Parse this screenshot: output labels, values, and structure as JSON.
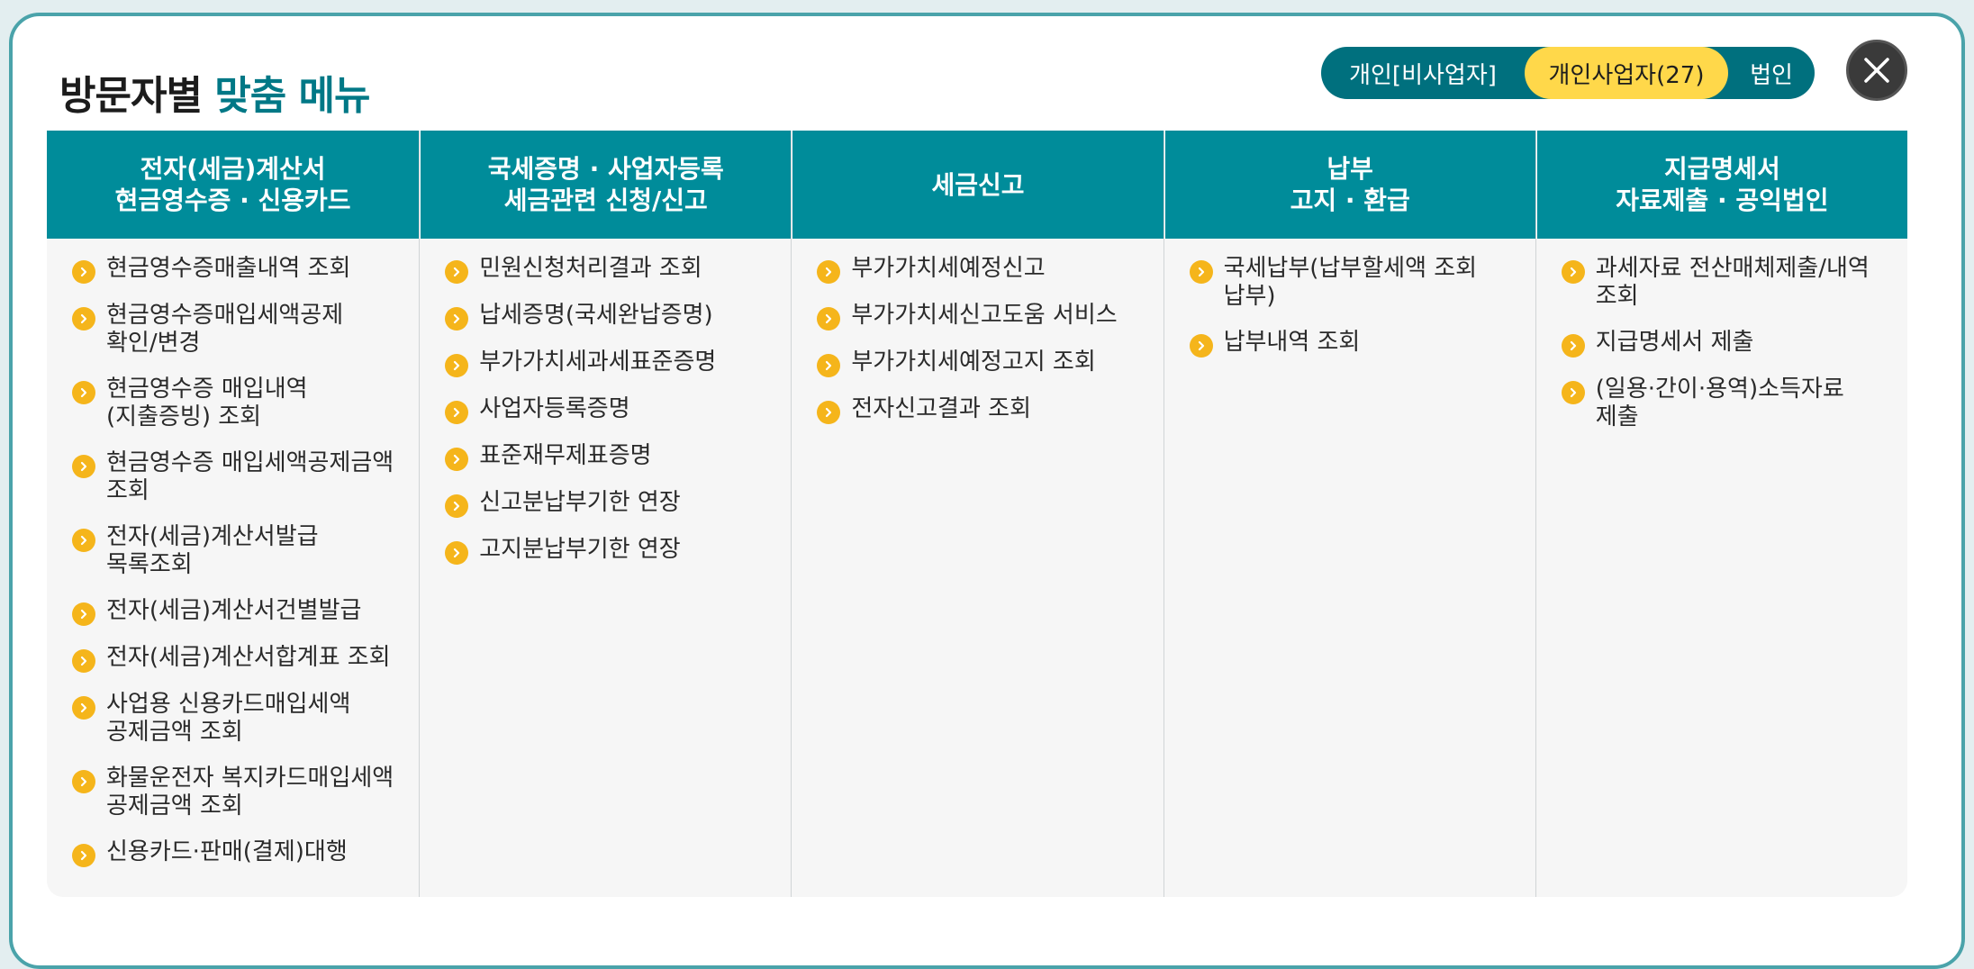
{
  "title": {
    "main": "방문자별",
    "accent": "맞춤 메뉴"
  },
  "toggle": {
    "options": [
      "개인[비사업자]",
      "개인사업자(27)",
      "법인"
    ],
    "selected": "개인사업자(27)"
  },
  "close_icon": "close-icon",
  "colors": {
    "teal": "#008c9a",
    "dark_teal": "#00707e",
    "yellow": "#ffd84a",
    "bullet": "#f5b51b"
  },
  "columns": [
    {
      "header": [
        "전자(세금)계산서",
        "현금영수증 · 신용카드"
      ],
      "items": [
        "현금영수증매출내역 조회",
        "현금영수증매입세액공제 확인/변경",
        "현금영수증 매입내역(지출증빙) 조회",
        "현금영수증 매입세액공제금액 조회",
        "전자(세금)계산서발급 목록조회",
        "전자(세금)계산서건별발급",
        "전자(세금)계산서합계표 조회",
        "사업용 신용카드매입세액 공제금액 조회",
        "화물운전자 복지카드매입세액 공제금액 조회",
        "신용카드·판매(결제)대행"
      ]
    },
    {
      "header": [
        "국세증명 · 사업자등록",
        "세금관련 신청/신고"
      ],
      "items": [
        "민원신청처리결과 조회",
        "납세증명(국세완납증명)",
        "부가가치세과세표준증명",
        "사업자등록증명",
        "표준재무제표증명",
        "신고분납부기한 연장",
        "고지분납부기한 연장"
      ]
    },
    {
      "header": [
        "세금신고"
      ],
      "items": [
        "부가가치세예정신고",
        "부가가치세신고도움 서비스",
        "부가가치세예정고지 조회",
        "전자신고결과 조회"
      ]
    },
    {
      "header": [
        "납부",
        "고지 · 환급"
      ],
      "items": [
        "국세납부(납부할세액 조회 납부)",
        "납부내역 조회"
      ]
    },
    {
      "header": [
        "지급명세서",
        "자료제출 · 공익법인"
      ],
      "items": [
        "과세자료 전산매체제출/내역 조회",
        "지급명세서 제출",
        "(일용·간이·용역)소득자료 제출"
      ]
    }
  ]
}
